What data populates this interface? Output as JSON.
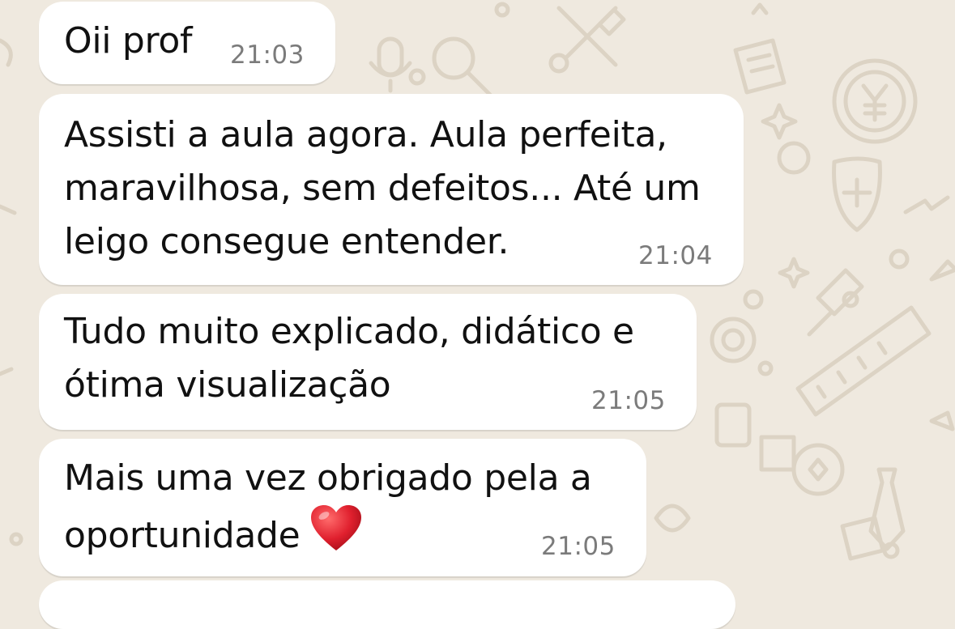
{
  "wallpaper": {
    "background_color": "#efe9df",
    "doodle_color": "#dcd3c4",
    "doodle_icons": [
      "microphone-icon",
      "magnifier-icon",
      "tools-icon",
      "receipt-icon",
      "coin-yen-icon",
      "star-icon",
      "shield-plus-icon",
      "pushpin-icon",
      "ruler-icon",
      "camera-icon",
      "tie-icon",
      "sparkle-icon",
      "plant-icon"
    ]
  },
  "messages": [
    {
      "text": "Oii prof",
      "time": "21:03"
    },
    {
      "text": "Assisti a aula agora. Aula perfeita,\nmaravilhosa, sem defeitos... Até um\nleigo consegue entender.",
      "time": "21:04"
    },
    {
      "text": "Tudo muito explicado, didático e\nótima visualização",
      "time": "21:05"
    },
    {
      "text": "Mais uma vez obrigado pela a\noportunidade",
      "emoji": "heart-icon",
      "time": "21:05"
    }
  ],
  "colors": {
    "bubble": "#ffffff",
    "text": "#111111",
    "timestamp": "#7b7b7b",
    "heart": "#e0202e"
  }
}
